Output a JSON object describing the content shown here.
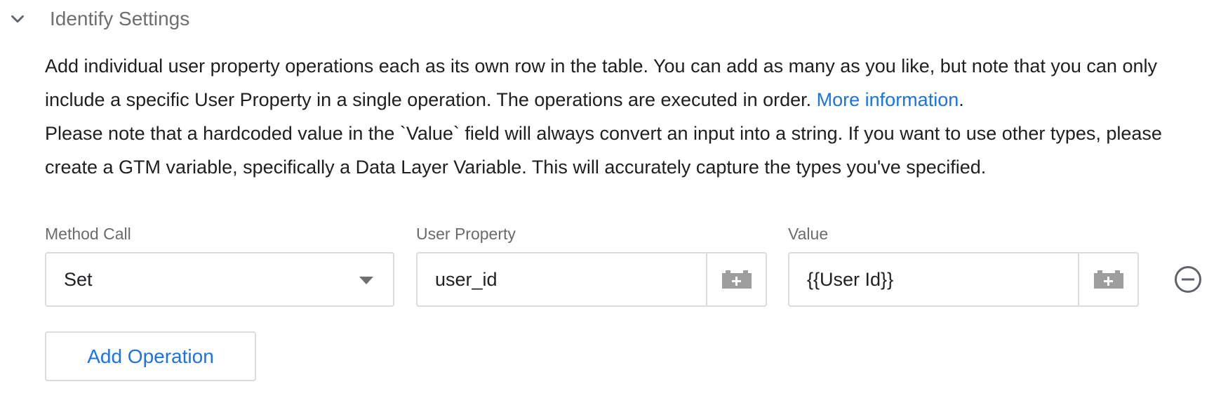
{
  "section": {
    "title": "Identify Settings",
    "chevron_icon": "chevron-down-icon"
  },
  "description": {
    "line1": "Add individual user property operations each as its own row in the table. You can add as many as you like, but note that you can only include a specific User Property in a single operation. The operations are executed in order. ",
    "more_info_link": "More information",
    "line1_end": ".",
    "line2": "Please note that a hardcoded value in the `Value` field will always convert an input into a string. If you want to use other types, please create a GTM variable, specifically a Data Layer Variable. This will accurately capture the types you've specified."
  },
  "table": {
    "columns": {
      "method_call": "Method Call",
      "user_property": "User Property",
      "value": "Value"
    },
    "rows": [
      {
        "method_call": "Set",
        "user_property": "user_id",
        "value": "{{User Id}}"
      }
    ]
  },
  "icons": {
    "variable_picker": "variable-picker-icon",
    "remove_row": "remove-row-icon",
    "dropdown": "dropdown-arrow-icon"
  },
  "colors": {
    "link": "#1a73e8",
    "border": "#dadce0",
    "muted_text": "#6f6f6f",
    "icon_gray": "#9e9e9e"
  },
  "add_button": {
    "label": "Add Operation"
  }
}
